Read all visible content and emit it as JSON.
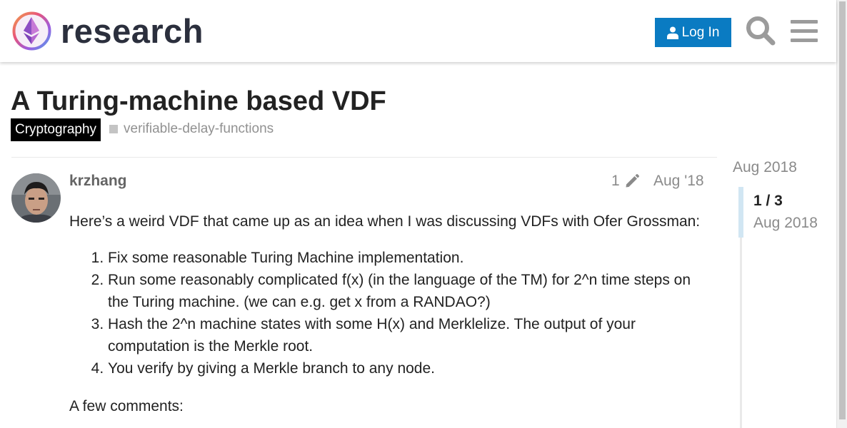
{
  "header": {
    "site_name": "research",
    "login_label": "Log In"
  },
  "topic": {
    "title": "A Turing-machine based VDF",
    "category": "Cryptography",
    "tag": "verifiable-delay-functions"
  },
  "post": {
    "username": "krzhang",
    "edit_count": "1",
    "date": "Aug '18",
    "intro": "Here’s a weird VDF that came up as an idea when I was discussing VDFs with Ofer Grossman:",
    "steps": [
      "Fix some reasonable Turing Machine implementation.",
      "Run some reasonably complicated f(x) (in the language of the TM) for 2^n time steps on the Turing machine. (we can e.g. get x from a RANDAO?)",
      "Hash the 2^n machine states with some H(x) and Merklelize. The output of your computation is the Merkle root.",
      "You verify by giving a Merkle branch to any node."
    ],
    "comments_heading": "A few comments:"
  },
  "timeline": {
    "start_date": "Aug 2018",
    "position": "1 / 3",
    "current_date": "Aug 2018"
  },
  "colors": {
    "accent": "#0a7bc2",
    "category_bg": "#000000",
    "timeline_handle": "#d1e6f3"
  },
  "icons": {
    "logo": "ethereum-research-logo",
    "login": "user-icon",
    "search": "search-icon",
    "menu": "hamburger-menu-icon",
    "edit": "pencil-icon"
  }
}
